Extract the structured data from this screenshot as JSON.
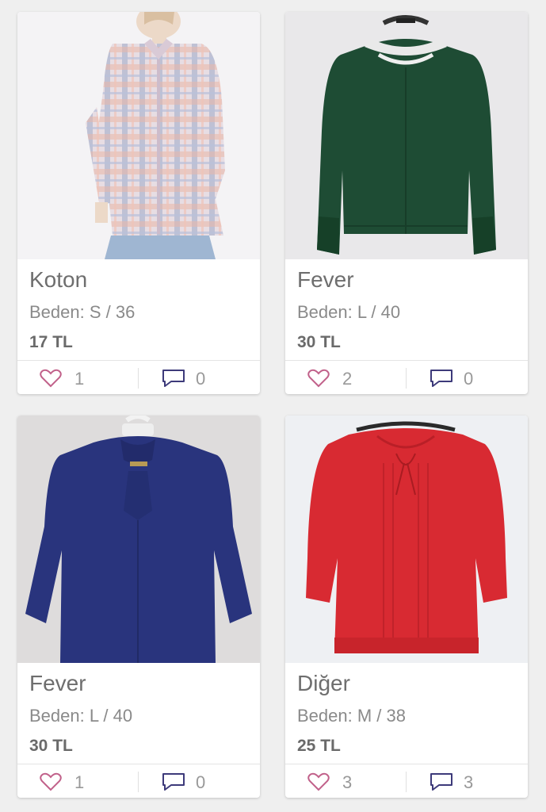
{
  "products": [
    {
      "brand": "Koton",
      "size": "Beden: S / 36",
      "price": "17 TL",
      "likes": "1",
      "comments": "0",
      "color": "#c9b6c6",
      "photo": "plaid-shirt"
    },
    {
      "brand": "Fever",
      "size": "Beden: L / 40",
      "price": "30 TL",
      "likes": "2",
      "comments": "0",
      "color": "#1f5136",
      "photo": "green-blouse"
    },
    {
      "brand": "Fever",
      "size": "Beden: L / 40",
      "price": "30 TL",
      "likes": "1",
      "comments": "0",
      "color": "#2a3580",
      "photo": "navy-blouse"
    },
    {
      "brand": "Diğer",
      "size": "Beden: M / 38",
      "price": "25 TL",
      "likes": "3",
      "comments": "3",
      "color": "#d82a32",
      "photo": "red-blouse"
    }
  ],
  "icons": {
    "like": "heart-icon",
    "comment": "comment-icon"
  },
  "colors": {
    "heart": "#c1618a",
    "comment": "#3d3a7a",
    "background": "#efefef"
  }
}
